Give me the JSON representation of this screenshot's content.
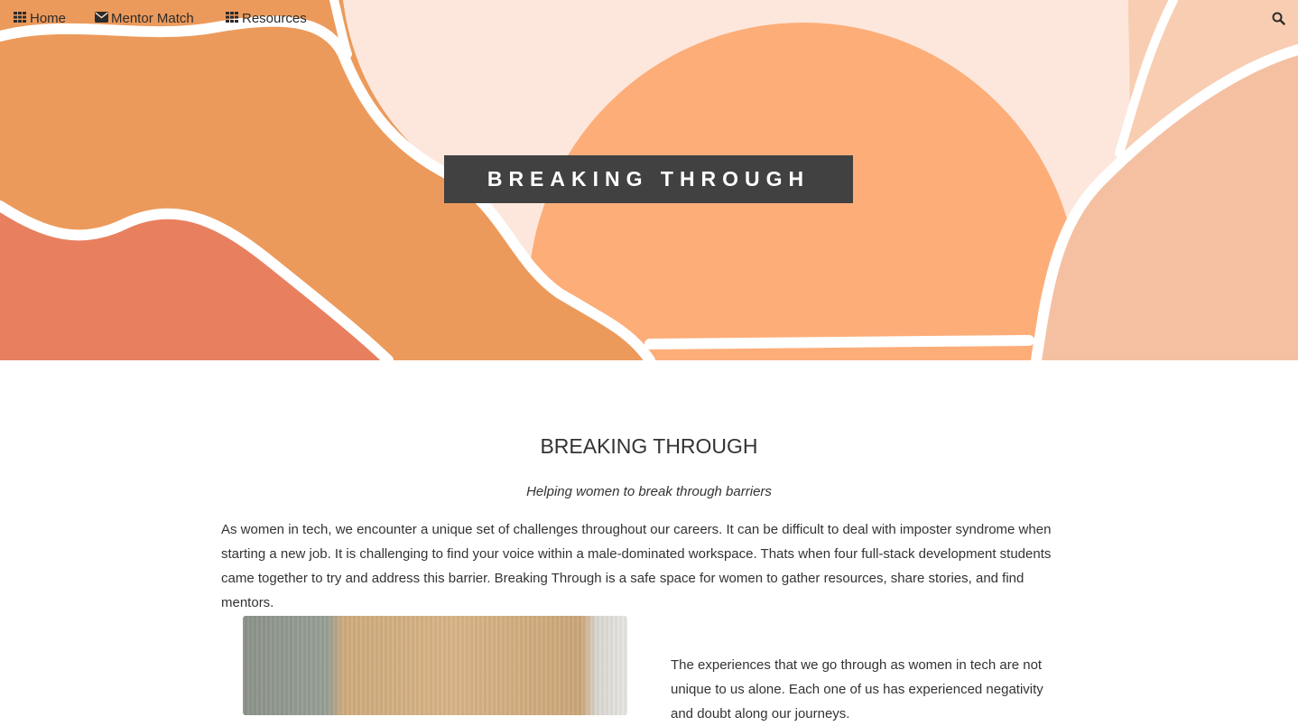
{
  "nav": {
    "items": [
      {
        "label": "Home",
        "icon": "grid-icon"
      },
      {
        "label": "Mentor Match",
        "icon": "envelope-icon"
      },
      {
        "label": "Resources",
        "icon": "grid-icon"
      }
    ],
    "search_icon": "search-icon"
  },
  "hero": {
    "banner_text": "BREAKING THROUGH",
    "colors": [
      "#e8805f",
      "#ec9a5b",
      "#fdad78",
      "#f5c0a2",
      "#fde7dc"
    ]
  },
  "main": {
    "title": "BREAKING THROUGH",
    "subtitle": "Helping women to break through barriers",
    "intro": "As women in tech, we encounter a unique set of challenges throughout our careers. It can be difficult to deal with imposter syndrome when starting a new job. It is challenging to find your voice within a male-dominated workspace. Thats when four full-stack development students came together to try and address this barrier. Breaking Through is a safe space for women to gather resources, share stories, and find mentors.",
    "side_text": "The experiences that we go through as women in tech are not unique to us alone. Each one of us has experienced negativity and doubt along our journeys."
  }
}
